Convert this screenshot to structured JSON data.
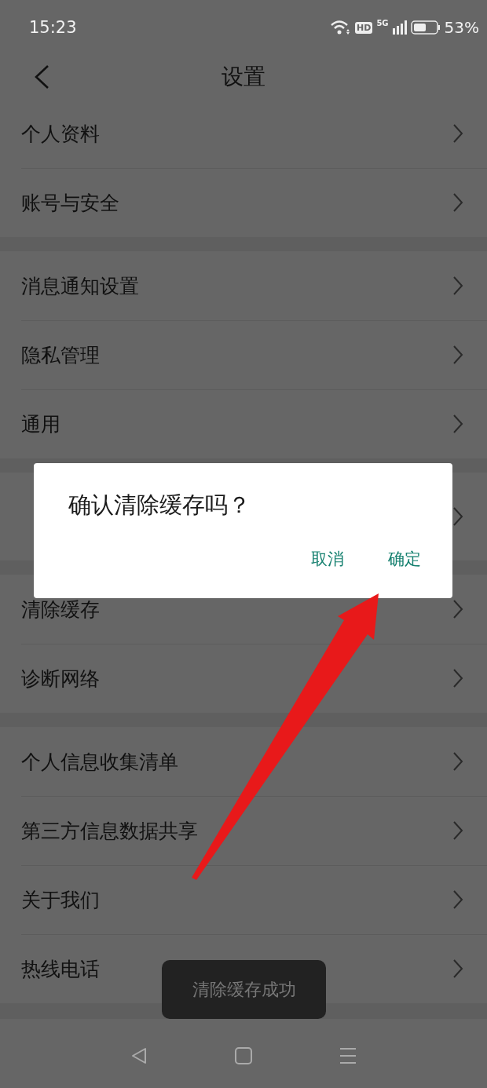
{
  "status_bar": {
    "time": "15:23",
    "hd": "HD",
    "network": "5G",
    "battery": "53%"
  },
  "header": {
    "title": "设置"
  },
  "groups": [
    {
      "items": [
        {
          "label": "个人资料"
        },
        {
          "label": "账号与安全"
        }
      ]
    },
    {
      "items": [
        {
          "label": "消息通知设置"
        },
        {
          "label": "隐私管理"
        },
        {
          "label": "通用"
        }
      ]
    },
    {
      "items": [
        {
          "kind": "covered"
        }
      ]
    },
    {
      "items": [
        {
          "label": "清除缓存"
        },
        {
          "label": "诊断网络"
        }
      ]
    },
    {
      "items": [
        {
          "label": "个人信息收集清单"
        },
        {
          "label": "第三方信息数据共享"
        },
        {
          "label": "关于我们"
        },
        {
          "label": "热线电话"
        }
      ]
    }
  ],
  "dialog": {
    "message": "确认清除缓存吗？",
    "buttons": [
      "取消",
      "确定"
    ]
  },
  "toast": "清除缓存成功"
}
